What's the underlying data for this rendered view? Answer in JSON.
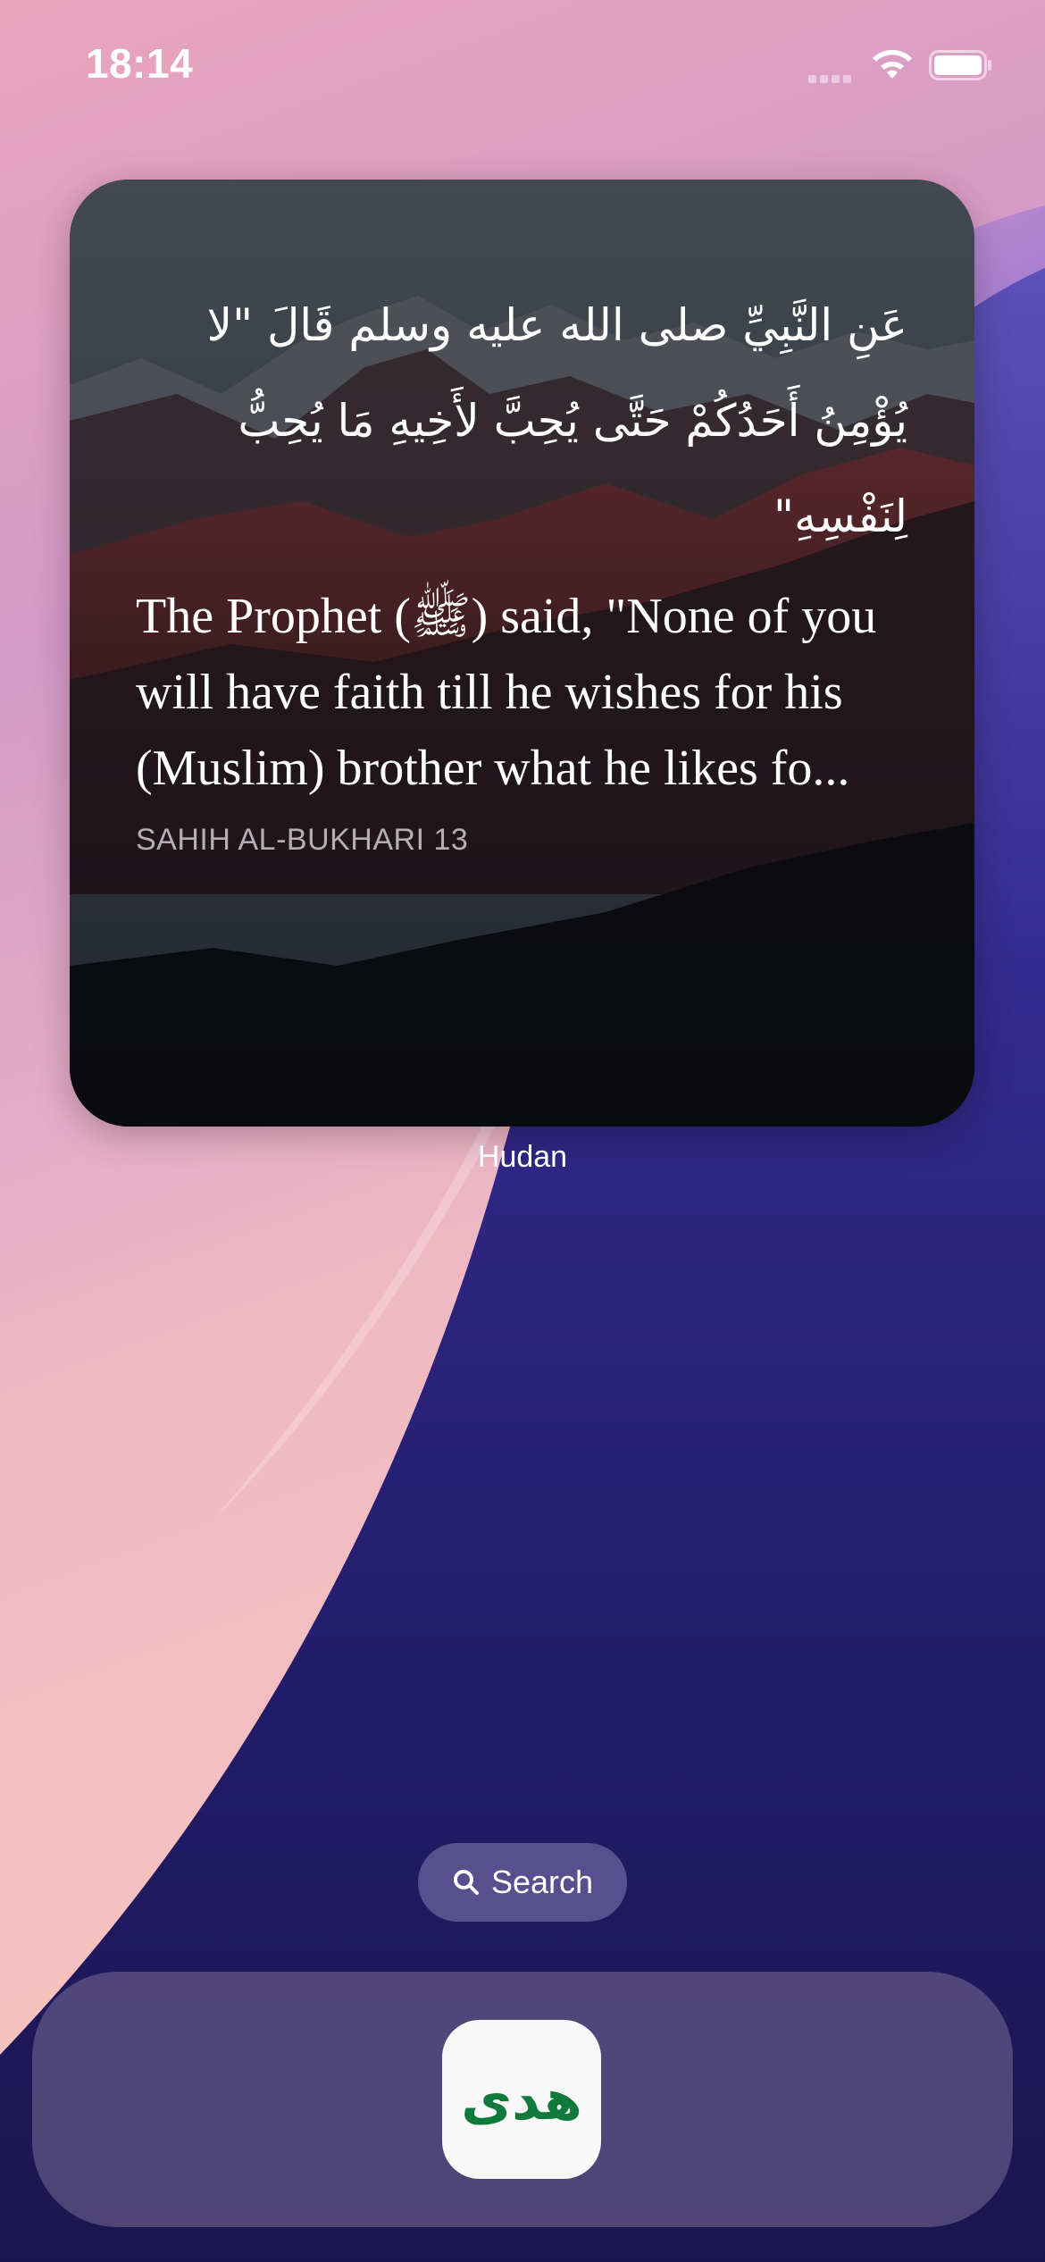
{
  "status_bar": {
    "time": "18:14"
  },
  "widget": {
    "arabic_text": "عَنِ النَّبِيِّ صلى الله عليه وسلم قَالَ \"لا يُؤْمِنُ أَحَدُكُمْ حَتَّى يُحِبَّ لأَخِيهِ مَا يُحِبُّ لِنَفْسِهِ\"",
    "english_text": "The Prophet (ﷺ) said, \"None of you\nwill have faith till he wishes for his\n(Muslim) brother what he likes fo...",
    "reference": "SAHIH AL-BUKHARI 13",
    "app_label": "Hudan"
  },
  "search": {
    "label": "Search"
  },
  "dock": {
    "apps": [
      {
        "name": "Hudan",
        "glyph": "هدى",
        "color": "#0f7a3c"
      }
    ]
  },
  "colors": {
    "icon_green": "#0f7a3c",
    "dock_bg": "#786e96",
    "wallpaper_navy": "#221a5c"
  }
}
